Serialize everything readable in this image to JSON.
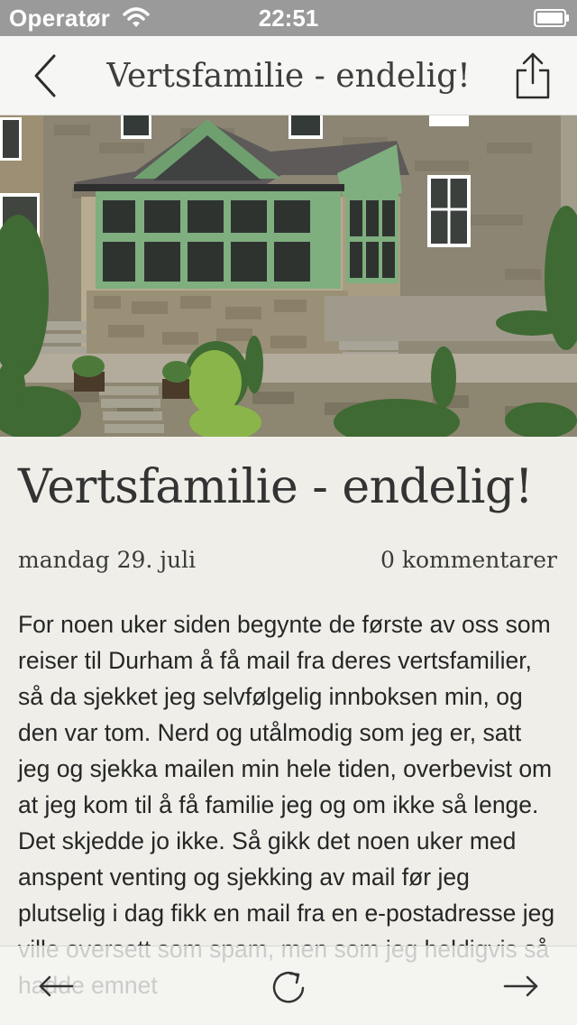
{
  "status_bar": {
    "carrier": "Operatør",
    "time": "22:51"
  },
  "nav": {
    "title": "Vertsfamilie - endelig!",
    "back_icon": "chevron-left-icon",
    "share_icon": "share-icon"
  },
  "article": {
    "title": "Vertsfamilie - endelig!",
    "date": "mandag 29. juli",
    "comments": "0 kommentarer",
    "body": "For noen uker siden begynte de første av oss som reiser til Durham å få mail fra deres vertsfamilier, så da sjekket jeg selvfølgelig innboksen min, og den var tom. Nerd og utålmodig som jeg er, satt jeg og sjekka mailen min hele tiden, overbevist om at jeg kom til å få familie jeg og om ikke så lenge. Det skjedde jo ikke. Så gikk det noen uker med anspent venting og sjekking av mail før jeg plutselig i dag fikk en mail fra en e-postadresse jeg ville oversett som spam, men som jeg heldigvis så hadde emnet"
  },
  "toolbar": {
    "prev_icon": "arrow-left-icon",
    "reload_icon": "reload-icon",
    "next_icon": "arrow-right-icon"
  },
  "colors": {
    "status_bar": "#9a9a9a",
    "nav_background": "#f6f6f4",
    "page_background": "#efeee9",
    "text": "#262626",
    "window_frame_green": "#7fae7f"
  }
}
